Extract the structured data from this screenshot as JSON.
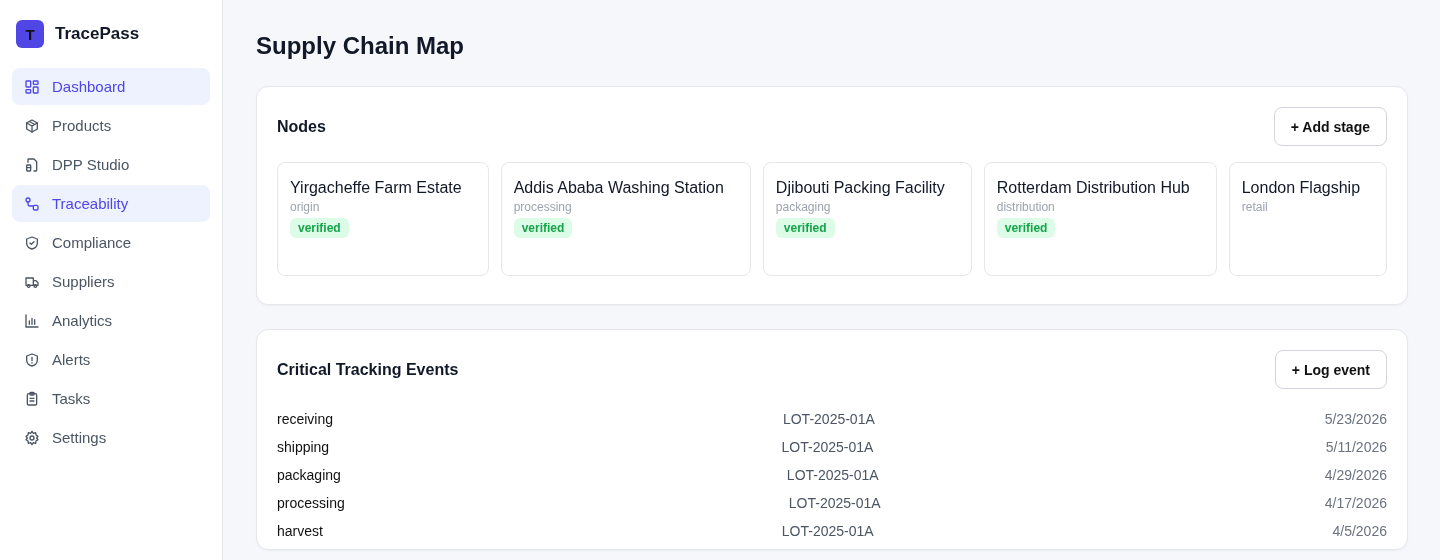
{
  "sidebar": {
    "logo": "T",
    "app_name": "TracePass",
    "items": [
      {
        "label": "Dashboard",
        "selected": true
      },
      {
        "label": "Products",
        "selected": false
      },
      {
        "label": "DPP Studio",
        "selected": false
      },
      {
        "label": "Traceability",
        "selected": true
      },
      {
        "label": "Compliance",
        "selected": false
      },
      {
        "label": "Suppliers",
        "selected": false
      },
      {
        "label": "Analytics",
        "selected": false
      },
      {
        "label": "Alerts",
        "selected": false
      },
      {
        "label": "Tasks",
        "selected": false
      },
      {
        "label": "Settings",
        "selected": false
      }
    ]
  },
  "page_title": "Supply Chain Map",
  "nodes_panel": {
    "title": "Nodes",
    "button": "+ Add stage",
    "nodes": [
      {
        "name": "Yirgacheffe Farm Estate",
        "stage": "origin",
        "status": "verified"
      },
      {
        "name": "Addis Ababa Washing Station",
        "stage": "processing",
        "status": "verified"
      },
      {
        "name": "Djibouti Packing Facility",
        "stage": "packaging",
        "status": "verified"
      },
      {
        "name": "Rotterdam Distribution Hub",
        "stage": "distribution",
        "status": "verified"
      },
      {
        "name": "London Flagship",
        "stage": "retail"
      }
    ]
  },
  "events_panel": {
    "title": "Critical Tracking Events",
    "button": "+ Log event",
    "events": [
      {
        "type": "receiving",
        "lot": "LOT-2025-01A",
        "date": "5/23/2026"
      },
      {
        "type": "shipping",
        "lot": "LOT-2025-01A",
        "date": "5/11/2026"
      },
      {
        "type": "packaging",
        "lot": "LOT-2025-01A",
        "date": "4/29/2026"
      },
      {
        "type": "processing",
        "lot": "LOT-2025-01A",
        "date": "4/17/2026"
      },
      {
        "type": "harvest",
        "lot": "LOT-2025-01A",
        "date": "4/5/2026"
      }
    ]
  }
}
